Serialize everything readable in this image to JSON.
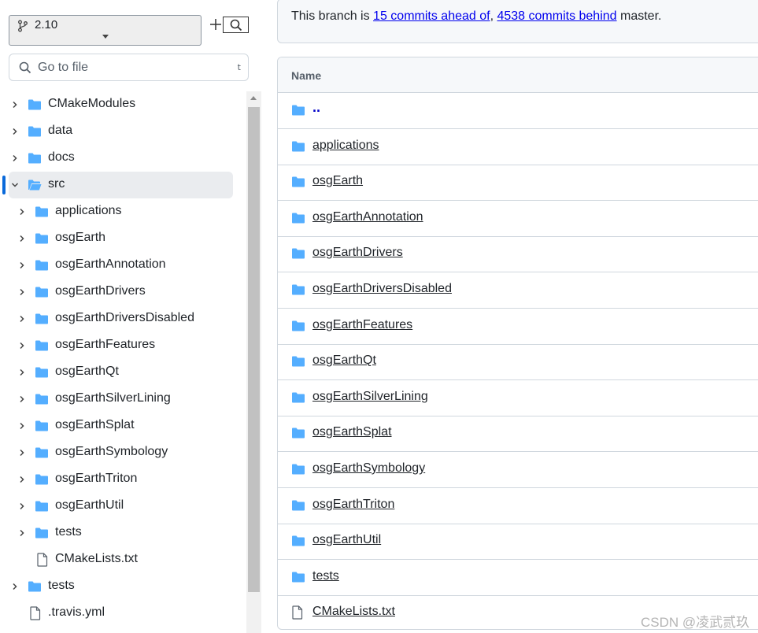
{
  "branch": {
    "name": "2.10"
  },
  "goto_file": {
    "placeholder": "Go to file",
    "shortcut": "t"
  },
  "tree": [
    {
      "label": "CMakeModules",
      "type": "folder",
      "expanded": false,
      "depth": 0
    },
    {
      "label": "data",
      "type": "folder",
      "expanded": false,
      "depth": 0
    },
    {
      "label": "docs",
      "type": "folder",
      "expanded": false,
      "depth": 0
    },
    {
      "label": "src",
      "type": "folder-open",
      "expanded": true,
      "depth": 0,
      "selected": true
    },
    {
      "label": "applications",
      "type": "folder",
      "expanded": false,
      "depth": 1
    },
    {
      "label": "osgEarth",
      "type": "folder",
      "expanded": false,
      "depth": 1
    },
    {
      "label": "osgEarthAnnotation",
      "type": "folder",
      "expanded": false,
      "depth": 1
    },
    {
      "label": "osgEarthDrivers",
      "type": "folder",
      "expanded": false,
      "depth": 1
    },
    {
      "label": "osgEarthDriversDisabled",
      "type": "folder",
      "expanded": false,
      "depth": 1
    },
    {
      "label": "osgEarthFeatures",
      "type": "folder",
      "expanded": false,
      "depth": 1
    },
    {
      "label": "osgEarthQt",
      "type": "folder",
      "expanded": false,
      "depth": 1
    },
    {
      "label": "osgEarthSilverLining",
      "type": "folder",
      "expanded": false,
      "depth": 1
    },
    {
      "label": "osgEarthSplat",
      "type": "folder",
      "expanded": false,
      "depth": 1
    },
    {
      "label": "osgEarthSymbology",
      "type": "folder",
      "expanded": false,
      "depth": 1
    },
    {
      "label": "osgEarthTriton",
      "type": "folder",
      "expanded": false,
      "depth": 1
    },
    {
      "label": "osgEarthUtil",
      "type": "folder",
      "expanded": false,
      "depth": 1
    },
    {
      "label": "tests",
      "type": "folder",
      "expanded": false,
      "depth": 1
    },
    {
      "label": "CMakeLists.txt",
      "type": "file",
      "depth": 1
    },
    {
      "label": "tests",
      "type": "folder",
      "expanded": false,
      "depth": 0
    },
    {
      "label": ".travis.yml",
      "type": "file",
      "depth": 0
    }
  ],
  "ahead_behind": {
    "prefix": "This branch is ",
    "ahead": "15 commits ahead of",
    "separator": ", ",
    "behind": "4538 commits behind",
    "suffix": " master."
  },
  "table": {
    "header": "Name",
    "rows": [
      {
        "name": "..",
        "type": "parent"
      },
      {
        "name": "applications",
        "type": "folder"
      },
      {
        "name": "osgEarth",
        "type": "folder"
      },
      {
        "name": "osgEarthAnnotation",
        "type": "folder"
      },
      {
        "name": "osgEarthDrivers",
        "type": "folder"
      },
      {
        "name": "osgEarthDriversDisabled",
        "type": "folder"
      },
      {
        "name": "osgEarthFeatures",
        "type": "folder"
      },
      {
        "name": "osgEarthQt",
        "type": "folder"
      },
      {
        "name": "osgEarthSilverLining",
        "type": "folder"
      },
      {
        "name": "osgEarthSplat",
        "type": "folder"
      },
      {
        "name": "osgEarthSymbology",
        "type": "folder"
      },
      {
        "name": "osgEarthTriton",
        "type": "folder"
      },
      {
        "name": "osgEarthUtil",
        "type": "folder"
      },
      {
        "name": "tests",
        "type": "folder"
      },
      {
        "name": "CMakeLists.txt",
        "type": "file"
      }
    ]
  },
  "watermark": "CSDN @凌武贰玖",
  "colors": {
    "folder": "#54aeff",
    "link": "#0000ee",
    "accent": "#0969da"
  }
}
